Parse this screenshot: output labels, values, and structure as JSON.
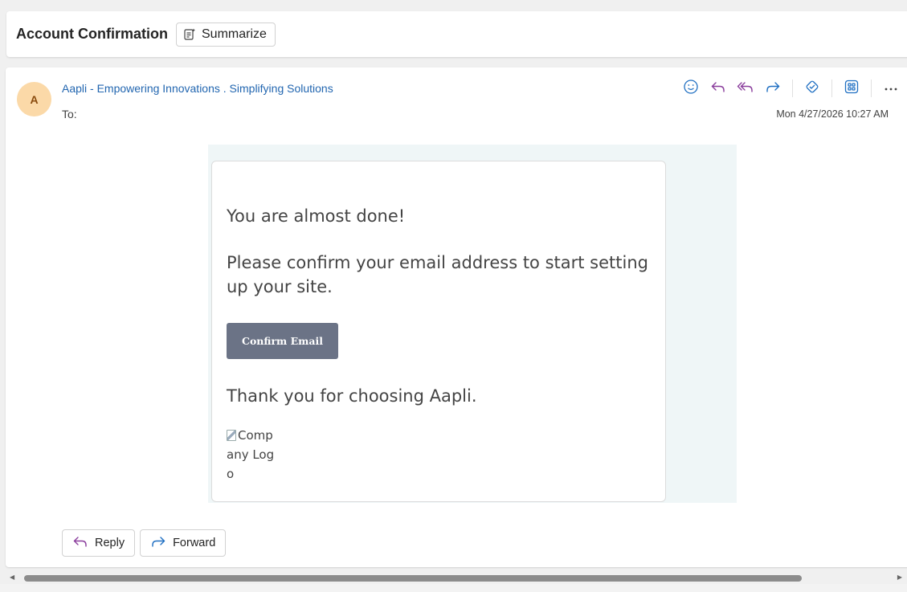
{
  "subject": {
    "title": "Account Confirmation",
    "summarize_label": "Summarize"
  },
  "message": {
    "avatar_initial": "A",
    "sender": "Aapli - Empowering Innovations . Simplifying Solutions",
    "to_label": "To:",
    "date": "Mon 4/27/2026 10:27 AM",
    "actions": [
      {
        "name": "emoji-icon",
        "color": "#1f6fc2"
      },
      {
        "name": "reply-icon",
        "color": "#8a3d9c"
      },
      {
        "name": "reply-all-icon",
        "color": "#8a3d9c"
      },
      {
        "name": "forward-icon",
        "color": "#1f6fc2"
      },
      {
        "name": "copilot-icon",
        "color": "#1f6fc2"
      },
      {
        "name": "apps-icon",
        "color": "#1f6fc2"
      },
      {
        "name": "more-icon",
        "color": "#424242"
      }
    ]
  },
  "body": {
    "line1": "You are almost done!",
    "line2": "Please confirm your email address to start setting up your site.",
    "confirm_button": "Confirm Email",
    "line3": "Thank you for choosing Aapli.",
    "logo_alt": "Company Logo"
  },
  "footer": {
    "reply_label": "Reply",
    "forward_label": "Forward"
  },
  "colors": {
    "link": "#2266b0",
    "reply_accent": "#8a3d9c",
    "forward_accent": "#1f6fc2",
    "confirm_button_bg": "#6b7386",
    "email_bg": "#eff6f7",
    "avatar_bg": "#fbd9a8"
  }
}
